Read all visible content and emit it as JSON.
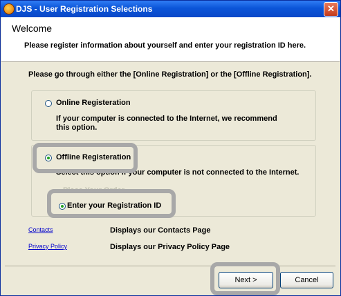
{
  "window": {
    "title": "DJS - User Registration Selections",
    "close_glyph": "✕"
  },
  "header": {
    "welcome": "Welcome",
    "intro": "Please register information about yourself and enter your registration ID here."
  },
  "instruction": "Please go through either the [Online Registration] or the [Offline Registration].",
  "online": {
    "label": "Online Registeration",
    "description": "If your computer is connected to the Internet, we recommend this option.",
    "selected": false
  },
  "offline": {
    "label": "Offline Registeration",
    "description": "Select this option if your computer is not connected to the Internet.",
    "selected": true,
    "sub_option_1": "Place Your Order",
    "sub_option_2": "Enter your Registration ID",
    "sub_option_2_selected": true
  },
  "links": [
    {
      "label": "Contacts",
      "description": "Displays our Contacts Page"
    },
    {
      "label": "Privacy Policy",
      "description": "Displays our Privacy Policy Page"
    }
  ],
  "buttons": {
    "next": "Next >",
    "cancel": "Cancel"
  },
  "icons": {
    "app": "djs-app-icon",
    "close": "close-icon"
  }
}
